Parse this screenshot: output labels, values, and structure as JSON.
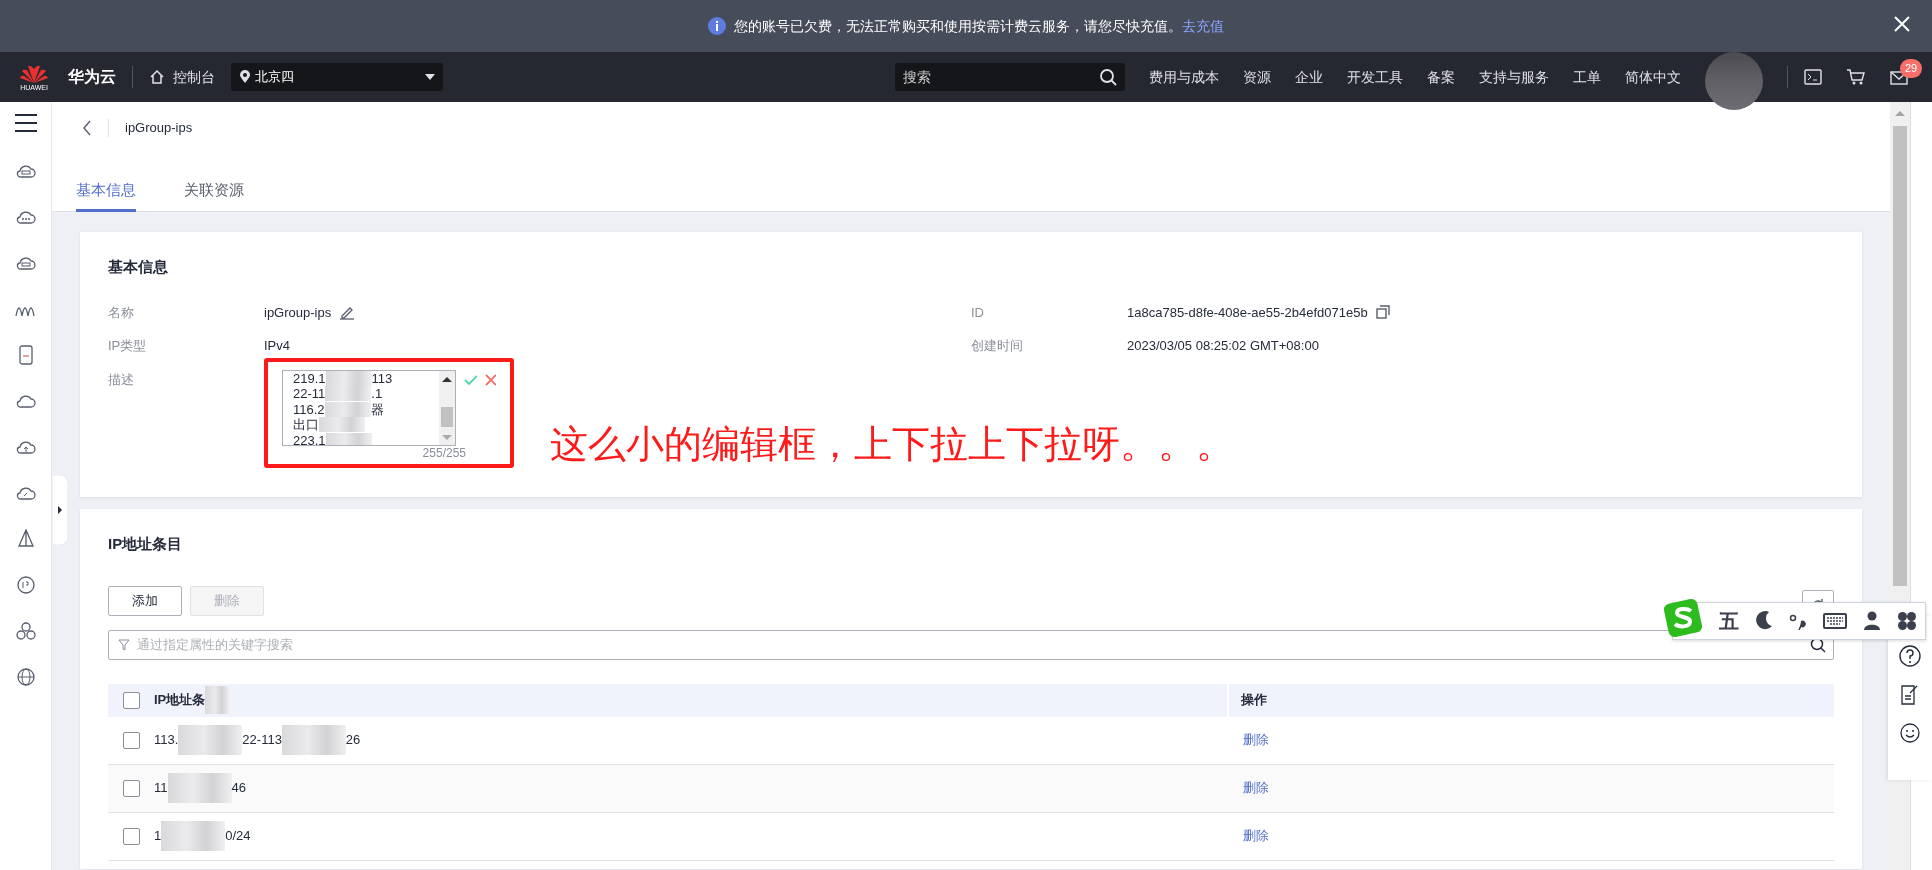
{
  "notice": {
    "text": "您的账号已欠费，无法正常购买和使用按需计费云服务，请您尽快充值。",
    "link": "去充值"
  },
  "header": {
    "logo_text": "HUAWEI",
    "brand": "华为云",
    "console": "控制台",
    "region": "北京四",
    "search_placeholder": "搜索",
    "nav": [
      "费用与成本",
      "资源",
      "企业",
      "开发工具",
      "备案",
      "支持与服务",
      "工单",
      "简体中文"
    ],
    "badge": "29"
  },
  "page": {
    "title": "ipGroup-ips",
    "tabs": [
      {
        "label": "基本信息",
        "selected": true
      },
      {
        "label": "关联资源",
        "selected": false
      }
    ]
  },
  "basic_info": {
    "title": "基本信息",
    "fields": [
      {
        "label": "名称",
        "value": "ipGroup-ips",
        "kind": "editable"
      },
      {
        "label": "ID",
        "value": "1a8ca785-d8fe-408e-ae55-2b4efd071e5b",
        "kind": "copyable"
      },
      {
        "label": "IP类型",
        "value": "IPv4",
        "kind": "plain"
      },
      {
        "label": "创建时间",
        "value": "2023/03/05 08:25:02 GMT+08:00",
        "kind": "plain"
      },
      {
        "label": "描述",
        "kind": "textarea",
        "counter": "255/255",
        "lines": [
          {
            "parts": [
              "219.1",
              "113"
            ]
          },
          {
            "parts": [
              "22-11",
              ".1"
            ]
          },
          {
            "parts": [
              "116.2",
              "器"
            ]
          },
          {
            "parts": [
              "出口"
            ]
          },
          {
            "parts": [
              "223.1"
            ]
          }
        ]
      }
    ]
  },
  "annotation": {
    "text": "这么小的编辑框，上下拉上下拉呀。。。"
  },
  "ip_entries": {
    "title": "IP地址条目",
    "buttons": [
      {
        "label": "添加",
        "disabled": false
      },
      {
        "label": "删除",
        "disabled": true
      }
    ],
    "search_placeholder": "通过指定属性的关键字搜索",
    "columns": [
      {
        "label": "IP地址条",
        "blurred": true
      },
      {
        "label": "操作",
        "blurred": false
      }
    ],
    "header_checked": false,
    "rows": [
      {
        "parts": [
          "113.",
          "22-113",
          "26"
        ],
        "checked": false,
        "action": "删除"
      },
      {
        "parts": [
          "11",
          "46"
        ],
        "checked": false,
        "action": "删除"
      },
      {
        "parts": [
          "1",
          "0/24"
        ],
        "checked": false,
        "action": "删除"
      }
    ]
  },
  "ime": {
    "mode": "五"
  }
}
